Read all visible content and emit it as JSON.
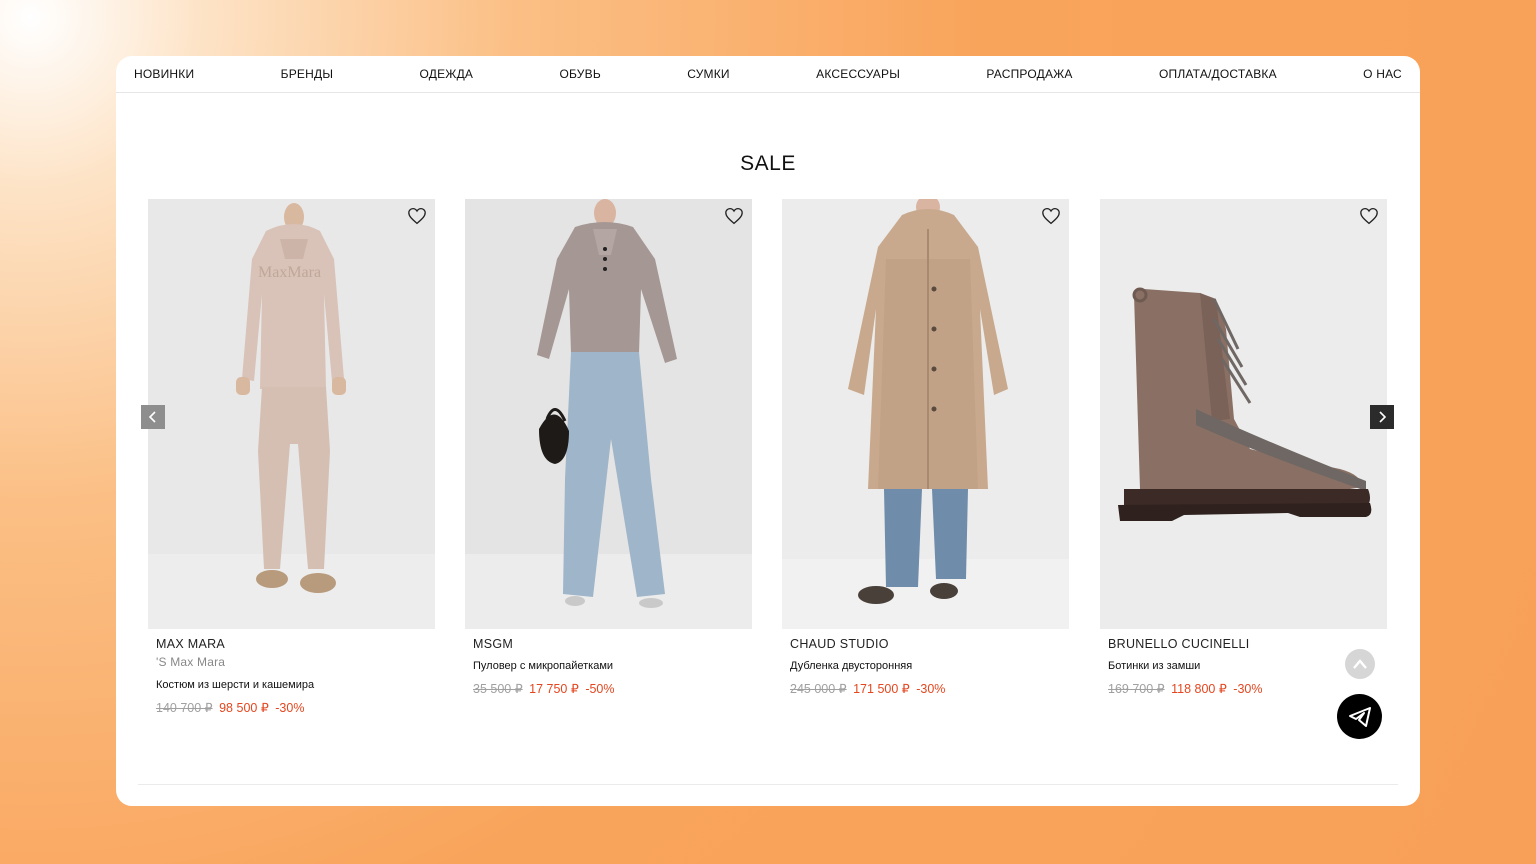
{
  "nav": {
    "items": [
      "НОВИНКИ",
      "БРЕНДЫ",
      "ОДЕЖДА",
      "ОБУВЬ",
      "СУМКИ",
      "АКСЕССУАРЫ",
      "РАСПРОДАЖА",
      "ОПЛАТА/ДОСТАВКА",
      "О НАС"
    ]
  },
  "section": {
    "title": "SALE"
  },
  "products": [
    {
      "brand": "MAX MARA",
      "subbrand": "'S Max Mara",
      "name": "Костюм из шерсти и кашемира",
      "old_price": "140 700 ₽",
      "new_price": "98 500 ₽",
      "discount": "-30%"
    },
    {
      "brand": "MSGM",
      "subbrand": "",
      "name": "Пуловер с микропайетками",
      "old_price": "35 500 ₽",
      "new_price": "17 750 ₽",
      "discount": "-50%"
    },
    {
      "brand": "CHAUD STUDIO",
      "subbrand": "",
      "name": "Дубленка двусторонняя",
      "old_price": "245 000 ₽",
      "new_price": "171 500 ₽",
      "discount": "-30%"
    },
    {
      "brand": "BRUNELLO CUCINELLI",
      "subbrand": "",
      "name": "Ботинки из замши",
      "old_price": "169 700 ₽",
      "new_price": "118 800 ₽",
      "discount": "-30%"
    }
  ],
  "icons": {
    "favorite": "heart-outline-icon",
    "prev": "chevron-left-icon",
    "next": "chevron-right-icon",
    "scroll_top": "chevron-up-icon",
    "telegram": "telegram-icon"
  },
  "colors": {
    "sale_red": "#e4471f",
    "old_price_gray": "#a0a0a0",
    "background_orange": "#f9a45b"
  }
}
